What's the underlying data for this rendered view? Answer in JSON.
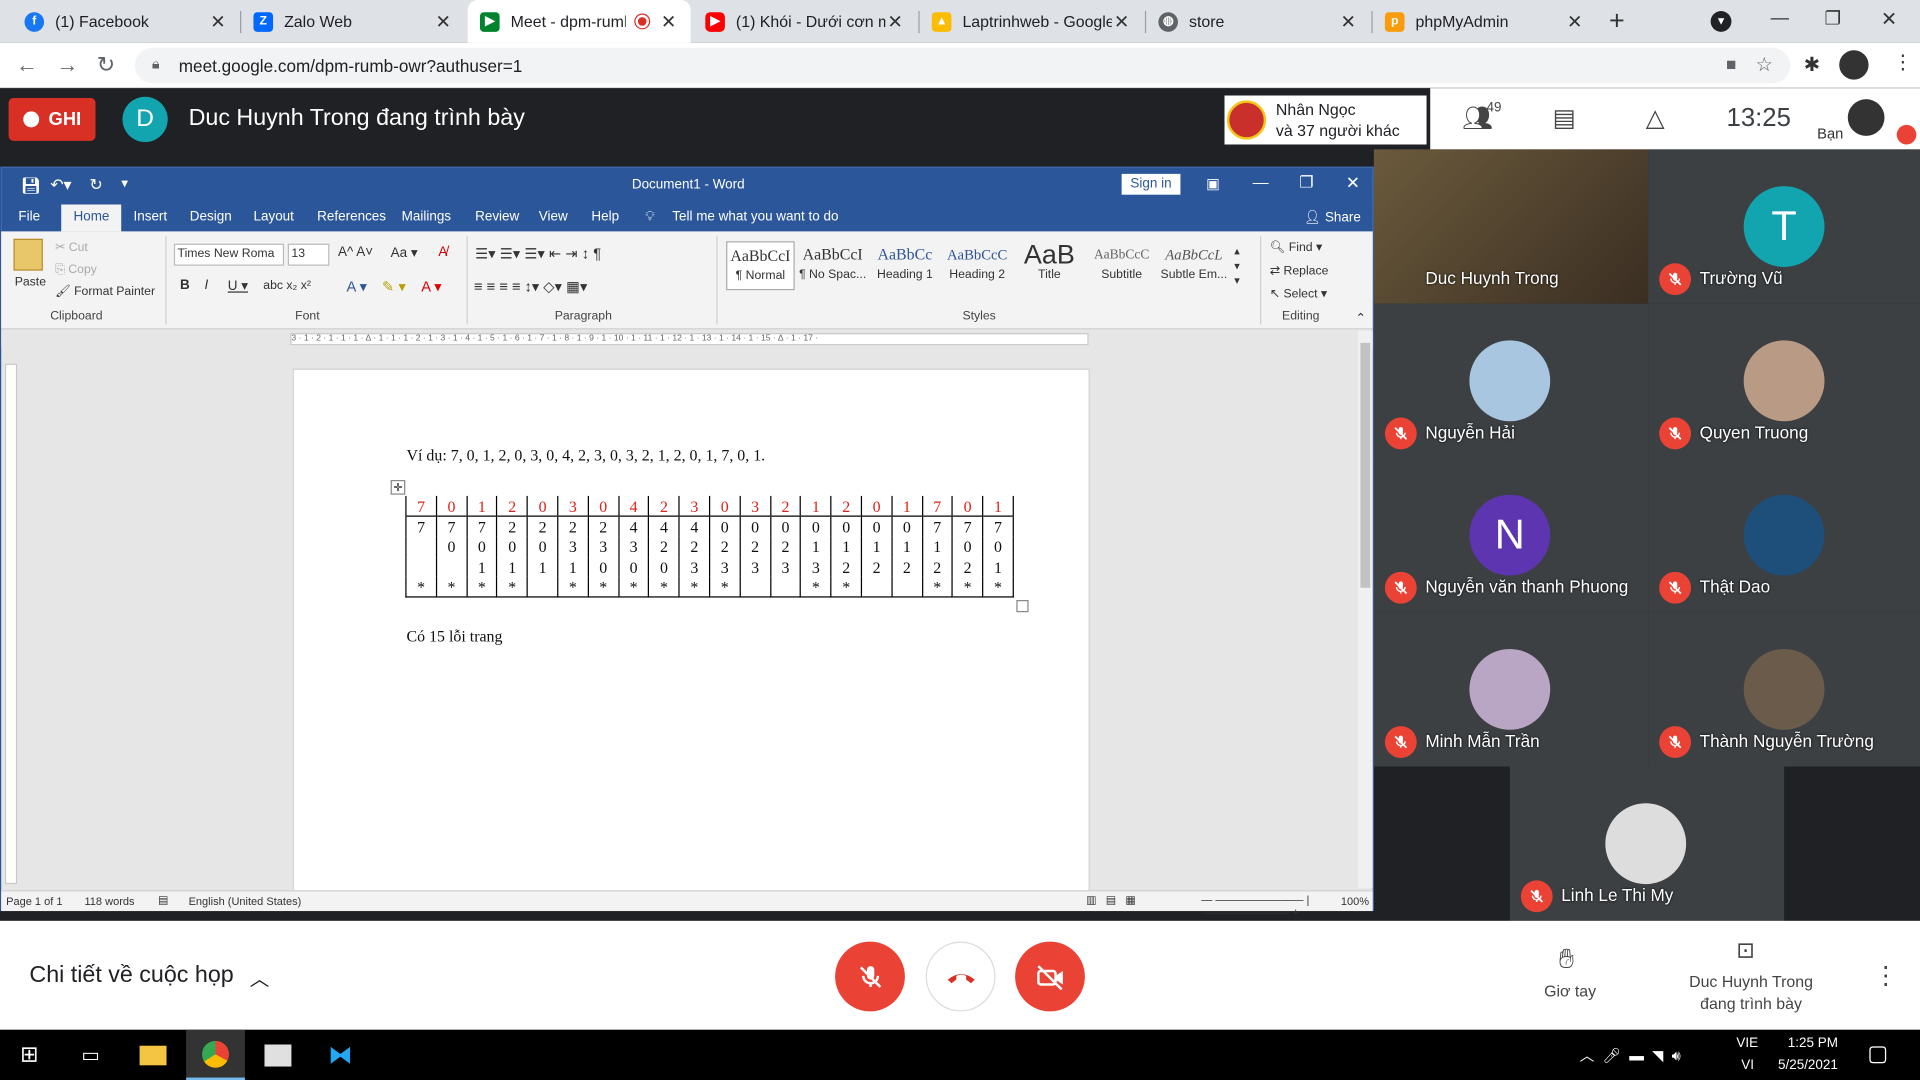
{
  "browser": {
    "tabs": [
      {
        "title": "(1) Facebook",
        "icon": "facebook-icon",
        "color": "#1877f2"
      },
      {
        "title": "Zalo Web",
        "icon": "zalo-icon",
        "color": "#0068ff"
      },
      {
        "title": "Meet - dpm-rumb",
        "icon": "meet-icon",
        "color": "#00832d"
      },
      {
        "title": "(1) Khói - Dưới cơn m",
        "icon": "youtube-icon",
        "color": "#ff0000"
      },
      {
        "title": "Laptrinhweb - Google",
        "icon": "drive-icon",
        "color": "#fbbc04"
      },
      {
        "title": "store",
        "icon": "globe-icon",
        "color": "#5f6368"
      },
      {
        "title": "phpMyAdmin",
        "icon": "phpmyadmin-icon",
        "color": "#f89c0e"
      }
    ],
    "url": "meet.google.com/dpm-rumb-owr?authuser=1"
  },
  "meet": {
    "record_label": "GHI",
    "presenter_initial": "D",
    "presenting_text": "Duc Huynh Trong đang trình bày",
    "participant_name": "Nhân Ngọc",
    "participant_others": "và 37 người khác",
    "people_count": "49",
    "clock": "13:25",
    "you_label": "Bạn",
    "details_label": "Chi tiết về cuộc họp",
    "raise_hand_label": "Giơ tay",
    "presenter_line1": "Duc Huynh Trong",
    "presenter_line2": "đang trình bày",
    "colors": {
      "red": "#ea4335",
      "dark": "#202124",
      "tile": "#3c4043"
    }
  },
  "tiles": [
    {
      "name": "Duc Huynh Trong",
      "type": "video",
      "muted": false
    },
    {
      "name": "Trường Vũ",
      "initial": "T",
      "color": "#12a4af",
      "muted": true
    },
    {
      "name": "Nguyễn Hải",
      "type": "photo",
      "color": "#a9c6e0",
      "muted": true
    },
    {
      "name": "Quyen Truong",
      "type": "photo",
      "color": "#b99a84",
      "muted": true
    },
    {
      "name": "Nguyễn văn thanh Phuong",
      "initial": "N",
      "color": "#5e35b1",
      "muted": true
    },
    {
      "name": "Thật Dao",
      "type": "photo",
      "color": "#1d4f7a",
      "muted": true
    },
    {
      "name": "Minh Mẫn Trần",
      "type": "photo",
      "color": "#b8a6c4",
      "muted": true
    },
    {
      "name": "Thành Nguyễn Trường",
      "type": "photo",
      "color": "#6b5b4b",
      "muted": true
    },
    {
      "name": "Linh Le Thi My",
      "type": "photo",
      "color": "#ddd",
      "muted": true
    }
  ],
  "word": {
    "title": "Document1 - Word",
    "sign_in": "Sign in",
    "tabs": [
      "File",
      "Home",
      "Insert",
      "Design",
      "Layout",
      "References",
      "Mailings",
      "Review",
      "View",
      "Help"
    ],
    "tell_me": "Tell me what you want to do",
    "share": "Share",
    "clipboard": {
      "paste": "Paste",
      "cut": "Cut",
      "copy": "Copy",
      "format_painter": "Format Painter",
      "group": "Clipboard"
    },
    "font": {
      "name": "Times New Roma",
      "size": "13",
      "group": "Font"
    },
    "paragraph_group": "Paragraph",
    "styles_group": "Styles",
    "styles": [
      {
        "preview": "AaBbCcI",
        "name": "¶ Normal"
      },
      {
        "preview": "AaBbCcI",
        "name": "¶ No Spac..."
      },
      {
        "preview": "AaBbCc",
        "name": "Heading 1"
      },
      {
        "preview": "AaBbCcC",
        "name": "Heading 2"
      },
      {
        "preview": "AaB",
        "name": "Title"
      },
      {
        "preview": "AaBbCcC",
        "name": "Subtitle"
      },
      {
        "preview": "AaBbCcL",
        "name": "Subtle Em..."
      }
    ],
    "editing": {
      "find": "Find",
      "replace": "Replace",
      "select": "Select",
      "group": "Editing"
    },
    "ruler_text": "3 · 1 · 2 · 1 · 1 · 1 · ∆ · 1 · 1 · 1 · 2 · 1 · 3 · 1 · 4 · 1 · 5 · 1 · 6 · 1 · 7 · 1 · 8 · 1 · 9 · 1 · 10 · 1 · 11 · 1 · 12 · 1 · 13 · 1 · 14 · 1 · 15 · ∆ · 1 · 17 ·",
    "doc_example": "Ví dụ: 7, 0, 1, 2, 0, 3, 0, 4, 2, 3, 0, 3, 2, 1, 2, 0, 1, 7, 0, 1.",
    "doc_result": "Có 15 lỗi trang",
    "table": [
      [
        "7",
        "0",
        "1",
        "2",
        "0",
        "3",
        "0",
        "4",
        "2",
        "3",
        "0",
        "3",
        "2",
        "1",
        "2",
        "0",
        "1",
        "7",
        "0",
        "1"
      ],
      [
        "7",
        "7",
        "7",
        "2",
        "2",
        "2",
        "2",
        "4",
        "4",
        "4",
        "0",
        "0",
        "0",
        "0",
        "0",
        "0",
        "0",
        "7",
        "7",
        "7"
      ],
      [
        "",
        "0",
        "0",
        "0",
        "0",
        "3",
        "3",
        "3",
        "2",
        "2",
        "2",
        "2",
        "2",
        "1",
        "1",
        "1",
        "1",
        "1",
        "0",
        "0"
      ],
      [
        "",
        "",
        "1",
        "1",
        "1",
        "1",
        "0",
        "0",
        "0",
        "3",
        "3",
        "3",
        "3",
        "3",
        "2",
        "2",
        "2",
        "2",
        "2",
        "1"
      ],
      [
        "*",
        "*",
        "*",
        "*",
        "",
        "*",
        "*",
        "*",
        "*",
        "*",
        "*",
        "",
        "",
        "*",
        "*",
        "",
        "",
        "*",
        "*",
        "*"
      ]
    ],
    "status": {
      "page": "Page 1 of 1",
      "words": "118 words",
      "lang": "English (United States)",
      "zoom": "100%"
    }
  },
  "taskbar": {
    "lang1": "VIE",
    "lang2": "VI",
    "time": "1:25 PM",
    "date": "5/25/2021"
  }
}
